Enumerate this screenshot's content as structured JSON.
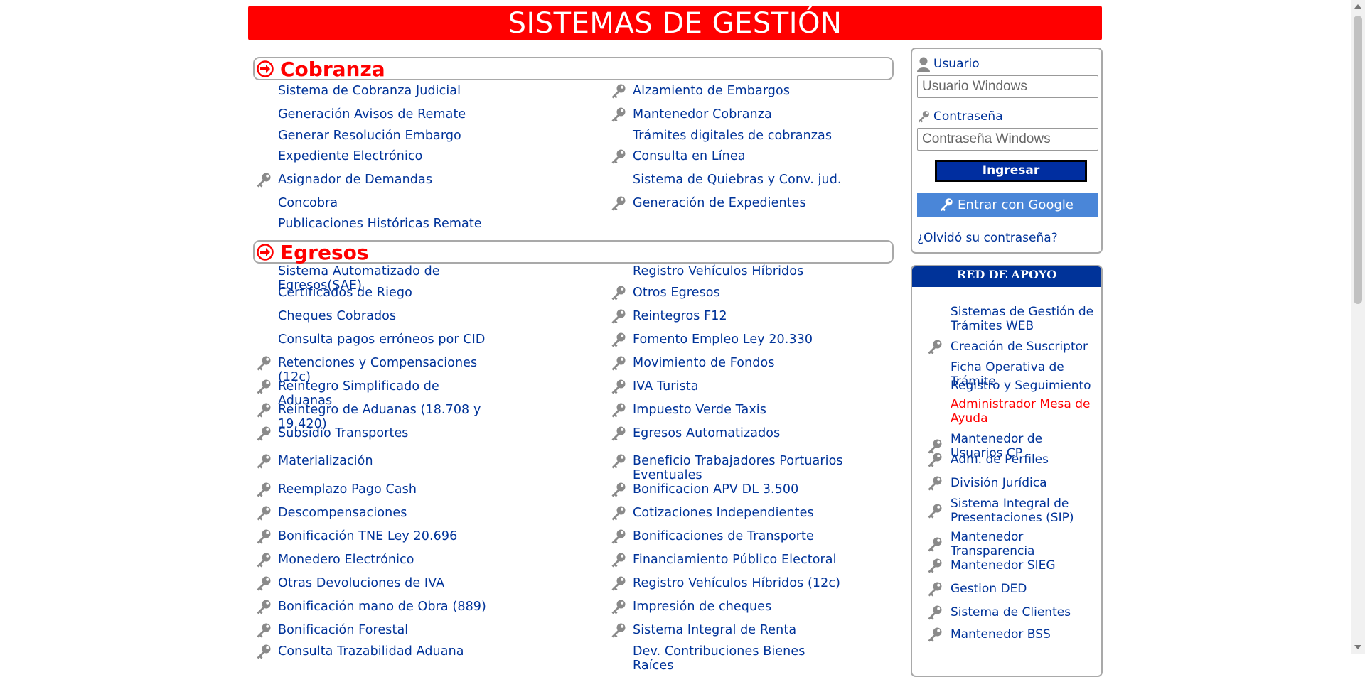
{
  "banner": {
    "title": "SISTEMAS DE GESTIÓN"
  },
  "sections": {
    "cobranza": {
      "title": "Cobranza",
      "left": [
        {
          "label": "Sistema de Cobranza Judicial",
          "key": false
        },
        {
          "label": "Generación Avisos de Remate",
          "key": false
        },
        {
          "label": "Generar Resolución Embargo",
          "key": false
        },
        {
          "label": "Expediente Electrónico",
          "key": false
        },
        {
          "label": "Asignador de Demandas",
          "key": true
        },
        {
          "label": "Concobra",
          "key": false
        },
        {
          "label": "Publicaciones Históricas Remate",
          "key": false
        }
      ],
      "right": [
        {
          "label": "Alzamiento de Embargos",
          "key": true
        },
        {
          "label": "Mantenedor Cobranza",
          "key": true
        },
        {
          "label": "Trámites digitales de cobranzas",
          "key": false
        },
        {
          "label": "Consulta en Línea",
          "key": true
        },
        {
          "label": "Sistema de Quiebras y Conv. jud.",
          "key": false
        },
        {
          "label": "Generación de Expedientes",
          "key": true
        }
      ]
    },
    "egresos": {
      "title": "Egresos",
      "left": [
        {
          "label": "Sistema Automatizado de Egresos(SAE)",
          "key": false
        },
        {
          "label": "Certificados de Riego",
          "key": false
        },
        {
          "label": "Cheques Cobrados",
          "key": false
        },
        {
          "label": "Consulta pagos erróneos por CID",
          "key": false
        },
        {
          "label": "Retenciones y Compensaciones (12c)",
          "key": true
        },
        {
          "label": "Reintegro Simplificado de Aduanas",
          "key": true
        },
        {
          "label": "Reintegro de Aduanas (18.708 y 19.420)",
          "key": true
        },
        {
          "label": "Subsidio Transportes",
          "key": true
        },
        {
          "label": "Materialización",
          "key": true
        },
        {
          "label": "Reemplazo Pago Cash",
          "key": true
        },
        {
          "label": "Descompensaciones",
          "key": true
        },
        {
          "label": "Bonificación TNE Ley 20.696",
          "key": true
        },
        {
          "label": "Monedero Electrónico",
          "key": true
        },
        {
          "label": "Otras Devoluciones de IVA",
          "key": true
        },
        {
          "label": "Bonificación mano de Obra (889)",
          "key": true
        },
        {
          "label": "Bonificación Forestal",
          "key": true
        },
        {
          "label": "Consulta Trazabilidad Aduana",
          "key": true
        }
      ],
      "right": [
        {
          "label": "Registro Vehículos Híbridos",
          "key": false
        },
        {
          "label": "Otros Egresos",
          "key": true
        },
        {
          "label": "Reintegros F12",
          "key": true
        },
        {
          "label": "Fomento Empleo Ley 20.330",
          "key": true
        },
        {
          "label": "Movimiento de Fondos",
          "key": true
        },
        {
          "label": "IVA Turista",
          "key": true
        },
        {
          "label": "Impuesto Verde Taxis",
          "key": true
        },
        {
          "label": "Egresos Automatizados",
          "key": true
        },
        {
          "label": "Beneficio Trabajadores Portuarios Eventuales",
          "key": true
        },
        {
          "label": "Bonificacion APV DL 3.500",
          "key": true
        },
        {
          "label": "Cotizaciones Independientes",
          "key": true
        },
        {
          "label": "Bonificaciones de Transporte",
          "key": true
        },
        {
          "label": "Financiamiento Público Electoral",
          "key": true
        },
        {
          "label": "Registro Vehículos Híbridos (12c)",
          "key": true
        },
        {
          "label": "Impresión de cheques",
          "key": true
        },
        {
          "label": "Sistema Integral de Renta",
          "key": true
        },
        {
          "label": "Dev. Contribuciones Bienes Raíces",
          "key": false
        }
      ]
    }
  },
  "login": {
    "user_label": "Usuario",
    "user_placeholder": "Usuario Windows",
    "pass_label": "Contraseña",
    "pass_placeholder": "Contraseña Windows",
    "submit_label": "Ingresar",
    "google_label": "Entrar con Google",
    "forgot_label": "¿Olvidó su contraseña?"
  },
  "red_apoyo": {
    "title": "RED DE APOYO",
    "items": [
      {
        "label": "Sistemas de Gestión de Trámites WEB",
        "key": false,
        "red": false
      },
      {
        "label": "Creación de Suscriptor",
        "key": true,
        "red": false
      },
      {
        "label": "Ficha Operativa de Trámite",
        "key": false,
        "red": false
      },
      {
        "label": "Registro y Seguimiento",
        "key": false,
        "red": false
      },
      {
        "label": "Administrador Mesa de Ayuda",
        "key": false,
        "red": true
      },
      {
        "label": "Mantenedor de Usuarios CP",
        "key": true,
        "red": false
      },
      {
        "label": "Adm. de Perfiles",
        "key": true,
        "red": false
      },
      {
        "label": "División Jurídica",
        "key": true,
        "red": false
      },
      {
        "label": "Sistema Integral de Presentaciones (SIP)",
        "key": true,
        "red": false
      },
      {
        "label": "Mantenedor Transparencia",
        "key": true,
        "red": false
      },
      {
        "label": "Mantenedor SIEG",
        "key": true,
        "red": false
      },
      {
        "label": "Gestion DED",
        "key": true,
        "red": false
      },
      {
        "label": "Sistema de Clientes",
        "key": true,
        "red": false
      },
      {
        "label": "Mantenedor BSS",
        "key": true,
        "red": false
      }
    ]
  },
  "colors": {
    "banner": "#ff0000",
    "link": "#003399",
    "section_title": "#ff0000",
    "button": "#002ea0",
    "google": "#4a86d8"
  }
}
